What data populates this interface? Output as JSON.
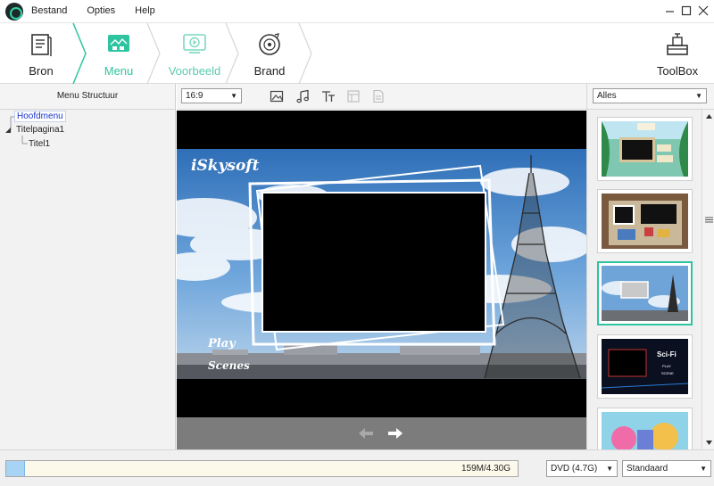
{
  "menu": {
    "items": [
      "Bestand",
      "Opties",
      "Help"
    ]
  },
  "steps": [
    {
      "label": "Bron",
      "icon": "document-icon",
      "active": false
    },
    {
      "label": "Menu",
      "icon": "menu-picture-icon",
      "active": true
    },
    {
      "label": "Voorbeeld",
      "icon": "play-preview-icon",
      "active": false
    },
    {
      "label": "Brand",
      "icon": "burn-disc-icon",
      "active": false
    }
  ],
  "toolbox": {
    "label": "ToolBox"
  },
  "left_panel": {
    "title": "Menu Structuur",
    "tree": {
      "root": "Hoofdmenu",
      "child": "Titelpagina1",
      "grandchild": "Titel1"
    }
  },
  "center_toolbar": {
    "aspect_ratio": "16:9"
  },
  "preview": {
    "brand_text": "iSkysoft",
    "buttons": {
      "play": "Play",
      "scenes": "Scenes"
    }
  },
  "right_panel": {
    "filter": "Alles"
  },
  "bottom": {
    "progress_text": "159M/4.30G",
    "progress_fraction": 0.037,
    "disc_type": "DVD (4.7G)",
    "quality": "Standaard"
  },
  "colors": {
    "accent": "#2ec4a0",
    "progress_fill": "#a7d3f5",
    "progress_bg": "#fcf9ea"
  }
}
